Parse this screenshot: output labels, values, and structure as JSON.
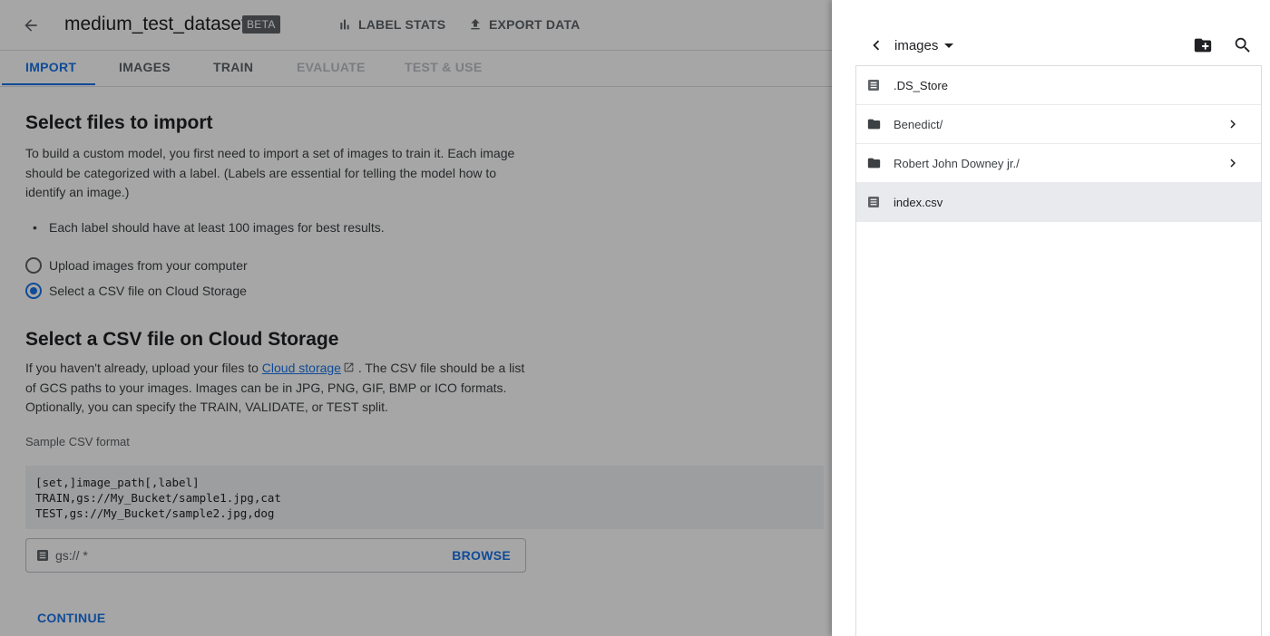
{
  "header": {
    "dataset_name": "medium_test_dataset",
    "badge": "BETA",
    "label_stats": "LABEL STATS",
    "export_data": "EXPORT DATA"
  },
  "tabs": [
    {
      "label": "IMPORT",
      "state": "active"
    },
    {
      "label": "IMAGES",
      "state": "normal"
    },
    {
      "label": "TRAIN",
      "state": "normal"
    },
    {
      "label": "EVALUATE",
      "state": "disabled"
    },
    {
      "label": "TEST & USE",
      "state": "disabled"
    }
  ],
  "import": {
    "title": "Select files to import",
    "intro": "To build a custom model, you first need to import a set of images to train it. Each image should be categorized with a label. (Labels are essential for telling the model how to identify an image.)",
    "bullet": "Each label should have at least 100 images for best results.",
    "options": [
      {
        "label": "Upload images from your computer",
        "checked": false
      },
      {
        "label": "Select a CSV file on Cloud Storage",
        "checked": true
      }
    ]
  },
  "csv": {
    "title": "Select a CSV file on Cloud Storage",
    "desc_before": "If you haven't already, upload your files to ",
    "link": "Cloud storage",
    "desc_after": " . The CSV file should be a list of GCS paths to your images. Images can be in JPG, PNG, GIF, BMP or ICO formats. Optionally, you can specify the TRAIN, VALIDATE, or TEST split.",
    "sample_label": "Sample CSV format",
    "sample_lines": [
      "[set,]image_path[,label]",
      "TRAIN,gs://My_Bucket/sample1.jpg,cat",
      "TEST,gs://My_Bucket/sample2.jpg,dog"
    ],
    "input_value": "gs:// *",
    "browse": "BROWSE",
    "continue": "CONTINUE"
  },
  "picker": {
    "folder": "images",
    "items": [
      {
        "name": ".DS_Store",
        "type": "file",
        "selected": false
      },
      {
        "name": "Benedict/",
        "type": "folder",
        "selected": false
      },
      {
        "name": "Robert John Downey jr./",
        "type": "folder",
        "selected": false
      },
      {
        "name": "index.csv",
        "type": "file",
        "selected": true
      }
    ]
  },
  "colors": {
    "accent": "#1a73e8",
    "overlay": "rgba(0,0,0,0.35)"
  }
}
